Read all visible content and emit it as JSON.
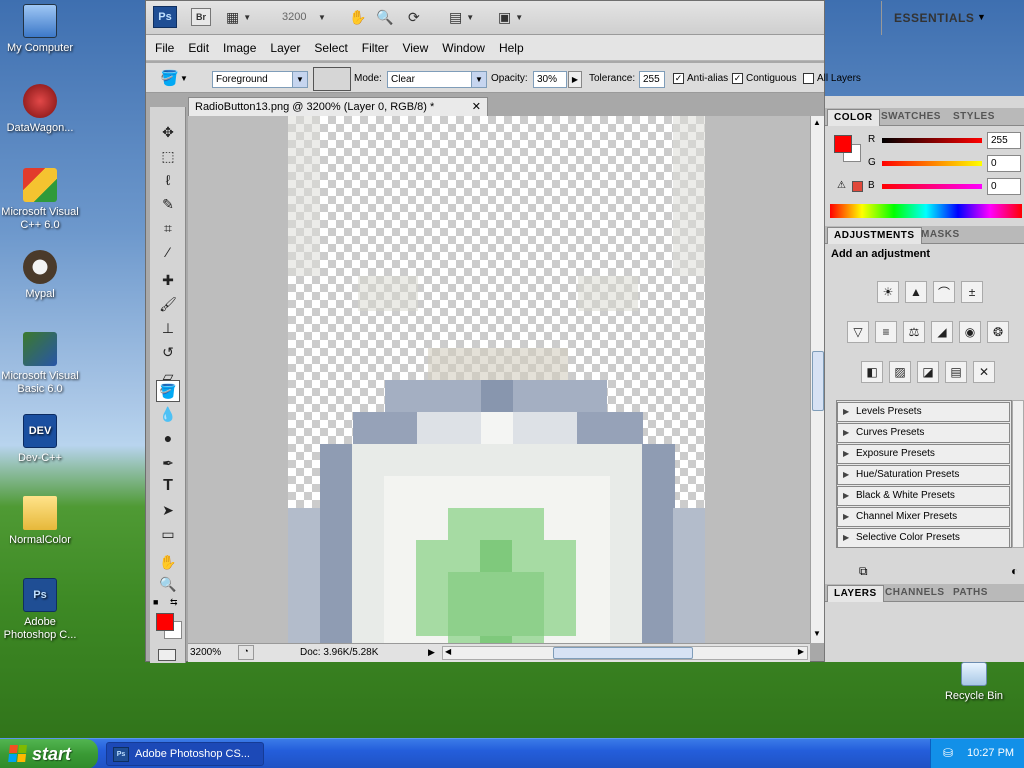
{
  "desktop": {
    "icons": [
      {
        "label": "My Computer",
        "icon": "computer-icon"
      },
      {
        "label": "DataWagon...",
        "icon": "datawagon-icon"
      },
      {
        "label": "Microsoft Visual C++ 6.0",
        "icon": "visual-cpp-icon"
      },
      {
        "label": "Mypal",
        "icon": "mypal-icon"
      },
      {
        "label": "Microsoft Visual Basic 6.0",
        "icon": "visual-basic-icon"
      },
      {
        "label": "Dev-C++",
        "icon": "devcpp-icon"
      },
      {
        "label": "NormalColor",
        "icon": "folder-icon"
      },
      {
        "label": "Adobe Photoshop C...",
        "icon": "photoshop-icon"
      },
      {
        "label": "Recycle Bin",
        "icon": "recycle-bin-icon"
      }
    ],
    "devcpp_badge": "DEV",
    "ps_badge": "Ps"
  },
  "app": {
    "logo": "Ps",
    "bridge": "Br",
    "zoom_box": "3200",
    "workspace": "ESSENTIALS",
    "menu": [
      "File",
      "Edit",
      "Image",
      "Layer",
      "Select",
      "Filter",
      "View",
      "Window",
      "Help"
    ]
  },
  "options": {
    "fill_source": "Foreground",
    "mode_label": "Mode:",
    "mode_value": "Clear",
    "opacity_label": "Opacity:",
    "opacity_value": "30%",
    "tolerance_label": "Tolerance:",
    "tolerance_value": "255",
    "anti_alias_label": "Anti-alias",
    "anti_alias_checked": true,
    "contiguous_label": "Contiguous",
    "contiguous_checked": true,
    "all_layers_label": "All Layers",
    "all_layers_checked": false
  },
  "document": {
    "tab_title": "RadioButton13.png @ 3200% (Layer 0, RGB/8) *",
    "zoom_status": "3200%",
    "doc_info": "Doc: 3.96K/5.28K"
  },
  "panels": {
    "color_tabs": [
      "COLOR",
      "SWATCHES",
      "STYLES"
    ],
    "r_label": "R",
    "g_label": "G",
    "b_label": "B",
    "r_value": "255",
    "g_value": "0",
    "b_value": "0",
    "foreground_color": "#ff0000",
    "adjust_tabs": [
      "ADJUSTMENTS",
      "MASKS"
    ],
    "add_adjustment": "Add an adjustment",
    "presets": [
      "Levels Presets",
      "Curves Presets",
      "Exposure Presets",
      "Hue/Saturation Presets",
      "Black & White Presets",
      "Channel Mixer Presets",
      "Selective Color Presets"
    ],
    "layer_tabs": [
      "LAYERS",
      "CHANNELS",
      "PATHS"
    ]
  },
  "taskbar": {
    "start": "start",
    "task": "Adobe Photoshop CS...",
    "clock": "10:27 PM"
  }
}
